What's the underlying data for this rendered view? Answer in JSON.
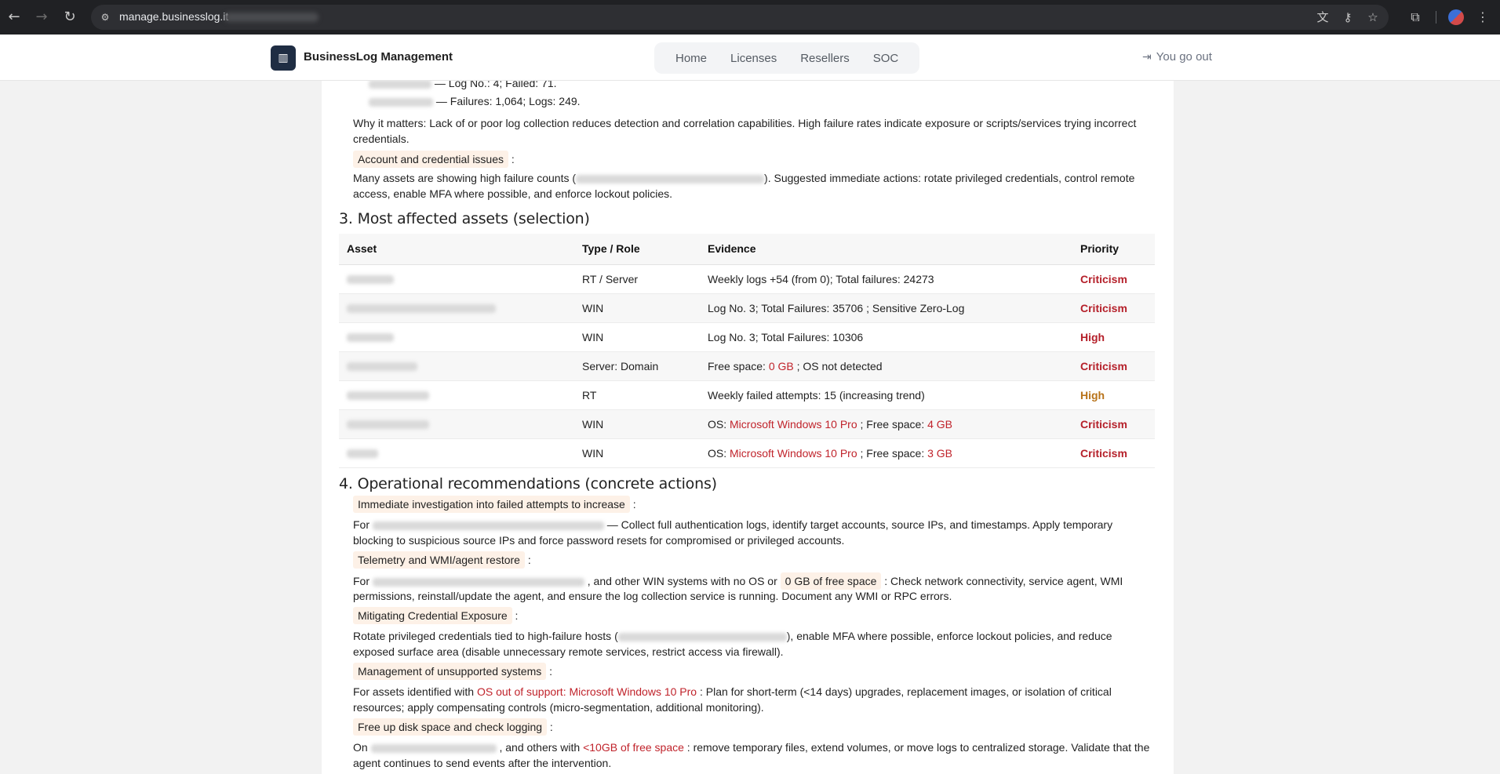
{
  "browser": {
    "url": "manage.businesslog.it"
  },
  "header": {
    "brand": "BusinessLog Management",
    "nav": [
      "Home",
      "Licenses",
      "Resellers",
      "SOC"
    ],
    "logout": "You go out"
  },
  "report": {
    "top_lines": [
      " — Log No.: 4; Failed: 71.",
      " — Failures: 1,064; Logs: 249."
    ],
    "why_matters": "Why it matters: Lack of or poor log collection reduces detection and correlation capabilities. High failure rates indicate exposure or scripts/services trying incorrect credentials.",
    "account_chip": "Account and credential issues",
    "account_text_a": "Many assets are showing high failure counts (",
    "account_text_b": "). Suggested immediate actions: rotate privileged credentials, control remote access, enable MFA where possible, and enforce lockout policies.",
    "section3": "3. Most affected assets (selection)",
    "table_headers": [
      "Asset",
      "Type / Role",
      "Evidence",
      "Priority"
    ],
    "rows": [
      {
        "type": "RT / Server",
        "evidence_a": "Weekly logs +54 (from 0); Total failures: 24273",
        "evidence_red": "",
        "evidence_b": "",
        "evidence_red2": "",
        "priority": "Criticism"
      },
      {
        "type": "WIN",
        "evidence_a": "Log No. 3; Total Failures: 35706 ; Sensitive Zero-Log",
        "evidence_red": "",
        "evidence_b": "",
        "evidence_red2": "",
        "priority": "Criticism"
      },
      {
        "type": "WIN",
        "evidence_a": "Log No. 3; Total Failures: 10306",
        "evidence_red": "",
        "evidence_b": "",
        "evidence_red2": "",
        "priority": "High"
      },
      {
        "type": "Server: Domain",
        "evidence_a": "Free space: ",
        "evidence_red": "0 GB",
        "evidence_b": " ; OS not detected",
        "evidence_red2": "",
        "priority": "Criticism"
      },
      {
        "type": "RT",
        "evidence_a": "Weekly failed attempts: 15 (increasing trend)",
        "evidence_red": "",
        "evidence_b": "",
        "evidence_red2": "",
        "priority": "High"
      },
      {
        "type": "WIN",
        "evidence_a": "OS: ",
        "evidence_red": "Microsoft Windows 10 Pro",
        "evidence_b": " ; Free space: ",
        "evidence_red2": "4 GB",
        "priority": "Criticism"
      },
      {
        "type": "WIN",
        "evidence_a": "OS: ",
        "evidence_red": "Microsoft Windows 10 Pro",
        "evidence_b": " ; Free space: ",
        "evidence_red2": "3 GB",
        "priority": "Criticism"
      }
    ],
    "section4": "4. Operational recommendations (concrete actions)",
    "rec1_chip": "Immediate investigation into failed attempts to increase",
    "rec1_a": "For ",
    "rec1_b": " — Collect full authentication logs, identify target accounts, source IPs, and timestamps. Apply temporary",
    "rec1_c": "blocking to suspicious source IPs and force password resets for compromised or privileged accounts.",
    "rec2_chip": "Telemetry and WMI/agent restore",
    "rec2_a": "For ",
    "rec2_b": " , and other WIN systems with no OS or ",
    "rec2_chip2": "0 GB of free space",
    "rec2_c": " : Check network connectivity, service agent, WMI",
    "rec2_d": "permissions, reinstall/update the agent, and ensure the log collection service is running. Document any WMI or RPC errors.",
    "rec3_chip": "Mitigating Credential Exposure",
    "rec3_a": "Rotate privileged credentials tied to high-failure hosts (",
    "rec3_b": "), enable MFA where possible, enforce lockout policies, and reduce",
    "rec3_c": "exposed surface area (disable unnecessary remote services, restrict access via firewall).",
    "rec4_chip": "Management of unsupported systems",
    "rec4_a": "For assets identified with ",
    "rec4_red": "OS out of support: Microsoft Windows 10 Pro",
    "rec4_b": " : Plan for short-term (<14 days) upgrades, replacement images, or isolation of critical",
    "rec4_c": "resources; apply compensating controls (micro-segmentation, additional monitoring).",
    "rec5_chip": "Free up disk space and check logging",
    "rec5_a": "On ",
    "rec5_b": " , and others with ",
    "rec5_red": "<10GB of free space",
    "rec5_c": " : remove temporary files, extend volumes, or move logs to centralized storage. Validate that the",
    "rec5_d": "agent continues to send events after the intervention.",
    "colon": " :"
  }
}
